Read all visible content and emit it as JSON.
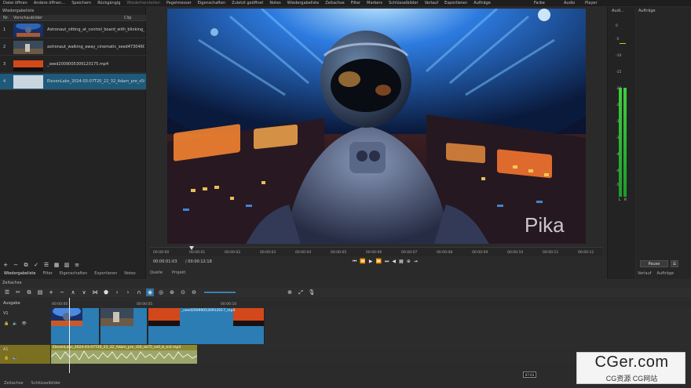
{
  "menu": {
    "items": [
      "Datei öffnen",
      "Andere öffnen…",
      "Speichern",
      "Rückgängig",
      "Wiederherstellen",
      "Pegelmesser",
      "Eigenschaften",
      "Zuletzt geöffnet",
      "Notes",
      "Wiedergabeliste",
      "Zeitachse",
      "Filter",
      "Markers",
      "Schlüsselbilder",
      "Verlauf",
      "Exportieren",
      "Aufträge"
    ],
    "right": [
      "Farbe",
      "Audio",
      "Player"
    ]
  },
  "playlist": {
    "title": "Wiedergabeliste",
    "columns": [
      "Nr.",
      "Vorschaubilder",
      "Clip"
    ],
    "rows": [
      {
        "num": "1",
        "name": "Astronaut_sitting_at_control_board_with_blinking_l",
        "selected": false
      },
      {
        "num": "2",
        "name": "astronaut_walking_away_cinematic_seed47304604",
        "selected": false
      },
      {
        "num": "3",
        "name": "_seed2009005309120175.mp4",
        "selected": false
      },
      {
        "num": "4",
        "name": "ElevenLabs_2024-03-07T20_22_32_Adam_pre_s50_s",
        "selected": true
      }
    ],
    "tabs": [
      "Wiedergabeliste",
      "Filter",
      "Eigenschaften",
      "Exportieren",
      "Notes"
    ]
  },
  "viewer": {
    "watermark": "Pika",
    "ruler_labels": [
      "00:00:00",
      "00:00:01",
      "00:00:02",
      "00:00:03",
      "00:00:04",
      "00:00:05",
      "00:00:06",
      "00:00:07",
      "00:00:08",
      "00:00:09",
      "00:00:10",
      "00:00:11",
      "00:00:12"
    ],
    "position": "00:00:01:03",
    "duration": "/ 00:00:12:18",
    "source_tabs": [
      "Quelle",
      "Projekt"
    ]
  },
  "audio": {
    "title": "Audi…",
    "db_labels": [
      "0",
      "-5",
      "-10",
      "-15",
      "-20",
      "-25",
      "-30",
      "-35",
      "-40",
      "-45",
      "-50"
    ],
    "channels": [
      "L",
      "R"
    ]
  },
  "jobs": {
    "title": "Aufträge",
    "pause_label": "Pause",
    "menu_label": "☰",
    "tabs": [
      "Verlauf",
      "Aufträge"
    ]
  },
  "timeline": {
    "title": "Zeitachse",
    "output_label": "Ausgabe",
    "ruler": [
      "00:00:00",
      "00:00:05",
      "00:00:10"
    ],
    "tracks": [
      {
        "label": "V1",
        "kind": "video"
      },
      {
        "label": "A1",
        "kind": "audio"
      }
    ],
    "video_clips": [
      {
        "name": ""
      },
      {
        "name": ""
      },
      {
        "name": "_seed200900530912017_mp4"
      }
    ],
    "audio_clip": "ElevenLabs_2024-03-07T20_22_32_Adam_pre_s50_sb75_se0_b_m2.mp3"
  },
  "bottom": {
    "tabs": [
      "Zeitachse",
      "Schlüsselbilder"
    ],
    "tc_badge": "07:03"
  },
  "brand": {
    "line1": "CGer.com",
    "line2": "CG资源 CG网站"
  }
}
